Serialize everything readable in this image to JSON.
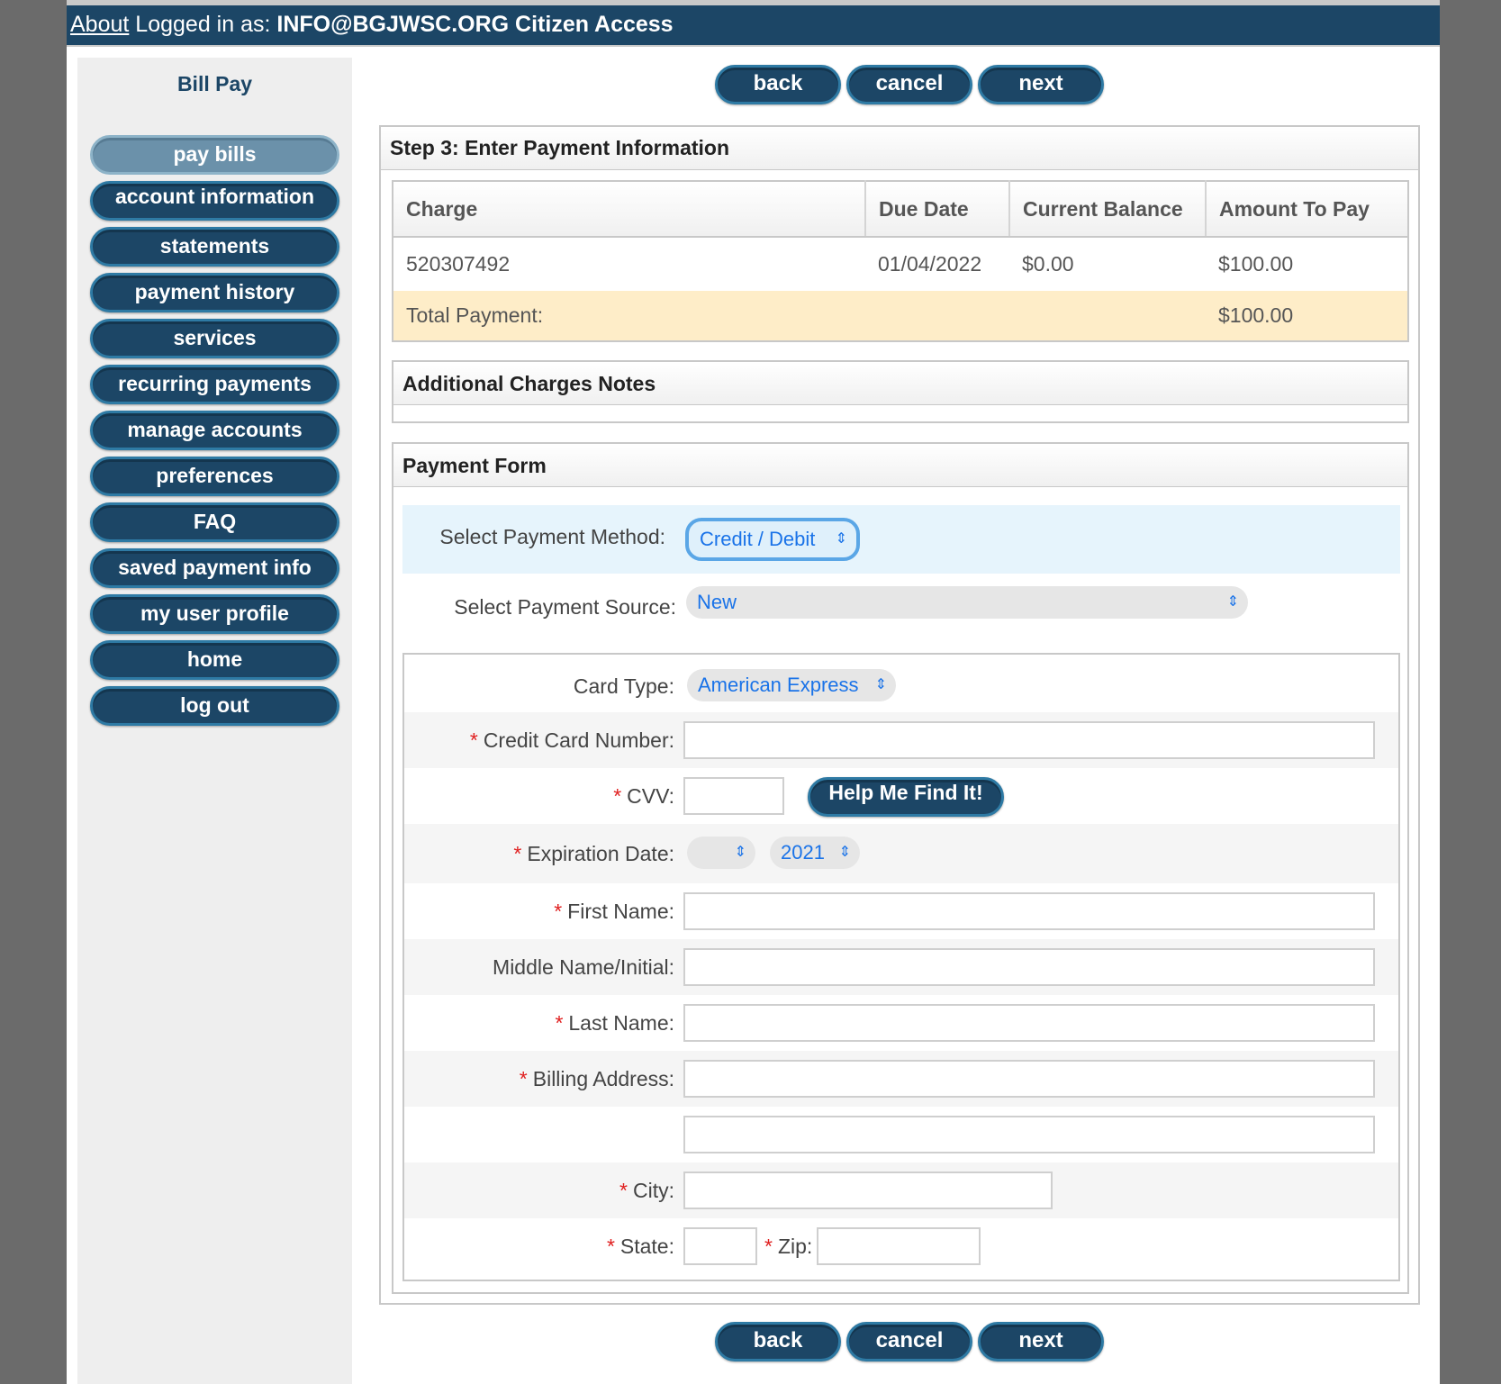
{
  "topbar": {
    "about_link": "About",
    "logged_in_prefix": "Logged in as:",
    "user": "INFO@BGJWSC.ORG",
    "app_name": "Citizen Access"
  },
  "sidebar": {
    "title": "Bill Pay",
    "items": [
      {
        "label": "pay bills",
        "active": true
      },
      {
        "label": "account information"
      },
      {
        "label": "statements"
      },
      {
        "label": "payment history"
      },
      {
        "label": "services"
      },
      {
        "label": "recurring payments"
      },
      {
        "label": "manage accounts"
      },
      {
        "label": "preferences"
      },
      {
        "label": "FAQ"
      },
      {
        "label": "saved payment info"
      },
      {
        "label": "my user profile"
      },
      {
        "label": "home"
      },
      {
        "label": "log out"
      }
    ]
  },
  "nav_buttons": {
    "back": "back",
    "cancel": "cancel",
    "next": "next"
  },
  "step_title": "Step 3: Enter Payment Information",
  "charges_table": {
    "headers": [
      "Charge",
      "Due Date",
      "Current Balance",
      "Amount To Pay"
    ],
    "rows": [
      [
        "520307492",
        "01/04/2022",
        "$0.00",
        "$100.00"
      ]
    ],
    "total_label": "Total Payment:",
    "total_value": "$100.00"
  },
  "additional_notes_title": "Additional Charges Notes",
  "payment_form": {
    "title": "Payment Form",
    "method_label": "Select Payment Method:",
    "method_value": "Credit / Debit",
    "source_label": "Select Payment Source:",
    "source_value": "New",
    "card_type_label": "Card Type:",
    "card_type_value": "American Express",
    "card_number_label": "Credit Card Number:",
    "cvv_label": "CVV:",
    "help_button": "Help Me Find It!",
    "expiration_label": "Expiration Date:",
    "expiration_month": "",
    "expiration_year": "2021",
    "first_name_label": "First Name:",
    "middle_name_label": "Middle Name/Initial:",
    "last_name_label": "Last Name:",
    "billing_address_label": "Billing Address:",
    "city_label": "City:",
    "state_label": "State:",
    "zip_label": "Zip:",
    "required_marker": "*"
  },
  "colors": {
    "brand_navy": "#1c4666",
    "button_border": "#2e7aa4",
    "active_nav": "#6b91aa",
    "total_row_bg": "#feedc8",
    "method_row_bg": "#e6f4fc",
    "required": "#e02020",
    "select_text": "#1a73e8"
  },
  "icons": {
    "select_chevron": "updown-chevron-icon"
  }
}
